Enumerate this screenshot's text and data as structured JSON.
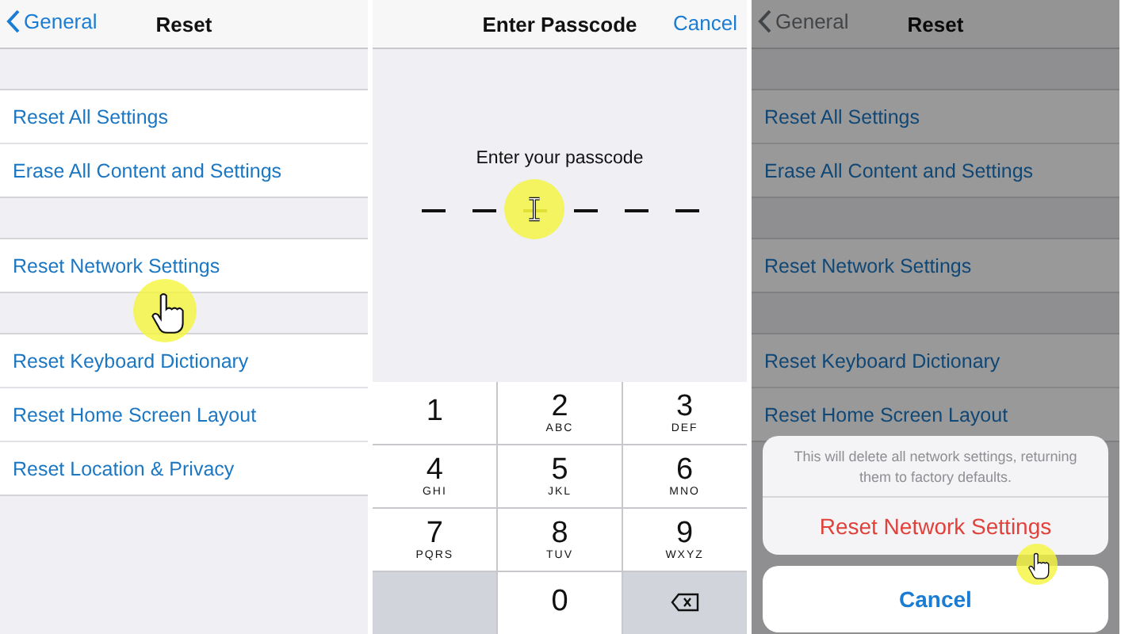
{
  "panels": [
    {
      "kind": "settings",
      "dimmed": false,
      "nav": {
        "back": "General",
        "title": "Reset"
      },
      "groups": [
        [
          {
            "label": "Reset All Settings",
            "tapped": false
          },
          {
            "label": "Erase All Content and Settings",
            "tapped": false
          }
        ],
        [
          {
            "label": "Reset Network Settings",
            "tapped": true
          }
        ],
        [
          {
            "label": "Reset Keyboard Dictionary",
            "tapped": false
          },
          {
            "label": "Reset Home Screen Layout",
            "tapped": false
          },
          {
            "label": "Reset Location & Privacy",
            "tapped": false
          }
        ]
      ]
    },
    {
      "kind": "passcode",
      "nav": {
        "title": "Enter Passcode",
        "action": "Cancel"
      },
      "prompt": "Enter your passcode",
      "slots": [
        {
          "cursor": false
        },
        {
          "cursor": false
        },
        {
          "cursor": true
        },
        {
          "cursor": false
        },
        {
          "cursor": false
        },
        {
          "cursor": false
        }
      ],
      "keys": [
        {
          "kind": "digit",
          "digit": "1"
        },
        {
          "kind": "digit",
          "digit": "2",
          "letters": "ABC"
        },
        {
          "kind": "digit",
          "digit": "3",
          "letters": "DEF"
        },
        {
          "kind": "digit",
          "digit": "4",
          "letters": "GHI"
        },
        {
          "kind": "digit",
          "digit": "5",
          "letters": "JKL"
        },
        {
          "kind": "digit",
          "digit": "6",
          "letters": "MNO"
        },
        {
          "kind": "digit",
          "digit": "7",
          "letters": "PQRS"
        },
        {
          "kind": "digit",
          "digit": "8",
          "letters": "TUV"
        },
        {
          "kind": "digit",
          "digit": "9",
          "letters": "WXYZ"
        },
        {
          "kind": "blank"
        },
        {
          "kind": "digit",
          "digit": "0"
        },
        {
          "kind": "delete"
        }
      ]
    },
    {
      "kind": "settings",
      "dimmed": true,
      "nav": {
        "back": "General",
        "title": "Reset"
      },
      "groups": [
        [
          {
            "label": "Reset All Settings",
            "tapped": false
          },
          {
            "label": "Erase All Content and Settings",
            "tapped": false
          }
        ],
        [
          {
            "label": "Reset Network Settings",
            "tapped": false
          }
        ],
        [
          {
            "label": "Reset Keyboard Dictionary",
            "tapped": false
          },
          {
            "label": "Reset Home Screen Layout",
            "tapped": false
          }
        ]
      ],
      "sheet": {
        "message": "This will delete all network settings, returning them to factory defaults.",
        "action": {
          "label": "Reset Network Settings",
          "tapped": true
        },
        "cancel": "Cancel"
      }
    }
  ]
}
